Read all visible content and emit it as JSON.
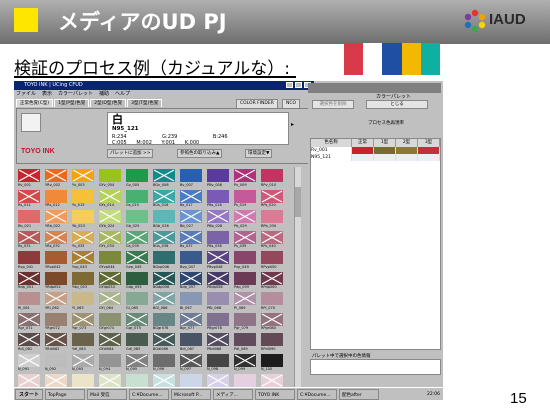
{
  "slide": {
    "title": "メディアのUD PJ",
    "logo_text": "IAUD",
    "subtitle": "検証のプロセス例（カジュアルな）:",
    "page_number": "15",
    "title_square_color": "#ffe600",
    "header_swatches": [
      "#d93a4a",
      "#ffffff",
      "#1f4fa3",
      "#f3b800",
      "#10b0a0"
    ]
  },
  "app": {
    "window_title": "TOYO INK | UCing CFUD",
    "menu": [
      "ファイル",
      "表示",
      "カラーパレット",
      "補助",
      "ヘルプ"
    ],
    "tabs": [
      "正常色覚(C型)",
      "1型(P型)色覚",
      "2型(D型)色覚",
      "3型(T型)色覚"
    ],
    "color_finder_label": "COLOR FINDER",
    "nco_label": "NCO",
    "selected_color": {
      "name": "白",
      "code": "N95_121",
      "rgb": [
        "R:234",
        "G:239",
        "B:246"
      ],
      "cmyk": [
        "C:005",
        "M:002",
        "Y:001",
        "K:000"
      ]
    },
    "brand": "TOYO INK",
    "buttons": [
      "パレットに追加 >>",
      "参照色の取り込み▲",
      "環境設定▼"
    ]
  },
  "swatch_grid": {
    "colors": [
      [
        "#c8242f",
        "#e86a1c",
        "#f2a30f",
        "#9ac21c",
        "#1e9a4c",
        "#138a8a",
        "#2a5fb0",
        "#5a3a9a",
        "#b0307a",
        "#c23462"
      ],
      [
        "#d34a4a",
        "#ef8a3a",
        "#f6c03a",
        "#b4d25a",
        "#48b070",
        "#3aa6a6",
        "#4a7cc6",
        "#7a5ab6",
        "#c45a9a",
        "#d0567a"
      ],
      [
        "#e06a6a",
        "#f39a5a",
        "#f8cc5a",
        "#c2dc7a",
        "#6ac28a",
        "#5ab8b8",
        "#6a94d2",
        "#9478c4",
        "#d07ab0",
        "#dc7a96"
      ],
      [
        "#b85858",
        "#d48452",
        "#d6ad50",
        "#a6b862",
        "#5aa676",
        "#4a9a9a",
        "#5a7cb6",
        "#7a64a6",
        "#b0648e",
        "#ba6a80"
      ],
      [
        "#8e3a3a",
        "#a85a30",
        "#a88030",
        "#7a8a3a",
        "#3a7a50",
        "#2e6e6e",
        "#3a5a8e",
        "#5a4680",
        "#8a466a",
        "#94485c"
      ],
      [
        "#6a3030",
        "#7a4a2a",
        "#7e6a34",
        "#5e6a34",
        "#2e5e40",
        "#245656",
        "#2e4670",
        "#463a66",
        "#6a3a56",
        "#70384a"
      ],
      [
        "#b89090",
        "#c4a088",
        "#c8b88a",
        "#aab48e",
        "#86a894",
        "#80a4a4",
        "#8898b4",
        "#9a8eb0",
        "#b092a8",
        "#b48e9c"
      ],
      [
        "#8a7070",
        "#9a8070",
        "#9e9272",
        "#8a9272",
        "#6a8a78",
        "#688686",
        "#6e7c94",
        "#7e7290",
        "#907488",
        "#94727e"
      ],
      [
        "#5a4a4a",
        "#665248",
        "#6a624c",
        "#5c624a",
        "#4a5c50",
        "#465a5a",
        "#4a5466",
        "#544c62",
        "#604c5c",
        "#644a54"
      ],
      [
        "#cfcfcf",
        "#bdbdbd",
        "#a9a9a9",
        "#959595",
        "#818181",
        "#6d6d6d",
        "#595959",
        "#454545",
        "#313131",
        "#1d1d1d"
      ],
      [
        "#e8d0d0",
        "#ecd8c8",
        "#ece4c8",
        "#dce4c8",
        "#c8e0d0",
        "#c8e0e0",
        "#cdd6e8",
        "#d6d0e8",
        "#e4d0e0",
        "#e8d0d8"
      ]
    ],
    "crossed": [
      [
        0,
        0
      ],
      [
        0,
        1
      ],
      [
        0,
        2
      ],
      [
        0,
        5
      ],
      [
        0,
        8
      ],
      [
        1,
        0
      ],
      [
        1,
        3
      ],
      [
        1,
        5
      ],
      [
        1,
        6
      ],
      [
        1,
        9
      ],
      [
        2,
        1
      ],
      [
        2,
        3
      ],
      [
        2,
        6
      ],
      [
        2,
        7
      ],
      [
        2,
        8
      ],
      [
        3,
        0
      ],
      [
        3,
        1
      ],
      [
        3,
        2
      ],
      [
        3,
        3
      ],
      [
        3,
        4
      ],
      [
        3,
        5
      ],
      [
        3,
        6
      ],
      [
        3,
        8
      ],
      [
        3,
        9
      ],
      [
        4,
        2
      ],
      [
        4,
        4
      ],
      [
        4,
        7
      ],
      [
        5,
        0
      ],
      [
        5,
        3
      ],
      [
        5,
        5
      ],
      [
        5,
        6
      ],
      [
        5,
        7
      ],
      [
        5,
        9
      ],
      [
        6,
        1
      ],
      [
        6,
        3
      ],
      [
        6,
        5
      ],
      [
        6,
        8
      ],
      [
        7,
        0
      ],
      [
        7,
        2
      ],
      [
        7,
        4
      ],
      [
        7,
        6
      ],
      [
        7,
        9
      ],
      [
        8,
        0
      ],
      [
        8,
        1
      ],
      [
        8,
        3
      ],
      [
        8,
        5
      ],
      [
        8,
        7
      ],
      [
        9,
        0
      ],
      [
        9,
        2
      ],
      [
        9,
        4
      ],
      [
        9,
        6
      ],
      [
        9,
        8
      ],
      [
        10,
        0
      ],
      [
        10,
        1
      ],
      [
        10,
        3
      ],
      [
        10,
        5
      ],
      [
        10,
        7
      ],
      [
        10,
        9
      ]
    ],
    "labels": [
      [
        "Rv_001",
        "YRv_002",
        "Yv_003",
        "GYv_004",
        "Gv_005",
        "BGv_006",
        "Bv_007",
        "PBv_008",
        "Pv_009",
        "RPv_010"
      ],
      [
        "Rs_011",
        "YRs_012",
        "Ys_013",
        "GYs_014",
        "Gs_015",
        "BGs_016",
        "Bs_017",
        "PBs_018",
        "Ps_019",
        "RPs_020"
      ],
      [
        "Rb_021",
        "YRb_022",
        "Yb_023",
        "GYb_024",
        "Gb_025",
        "BGb_026",
        "Bb_027",
        "PBb_028",
        "Pb_029",
        "RPb_030"
      ],
      [
        "Rs_031",
        "YRs_032",
        "Ys_033",
        "GYs_034",
        "Gs_035",
        "BGs_036",
        "Bs_037",
        "PBs_038",
        "Ps_039",
        "RPs_040"
      ],
      [
        "Rvp_041",
        "YRvp042",
        "Yvp_043",
        "GYvp044",
        "Gvp_045",
        "BGvp046",
        "Bvp_047",
        "PBvp048",
        "Pvp_049",
        "RPvp050"
      ],
      [
        "Rdp_051",
        "YRdp052",
        "Ydp_053",
        "GYdp054",
        "Gdp_055",
        "BGdp056",
        "Bdp_057",
        "PBdp058",
        "Pdp_059",
        "RPdp060"
      ],
      [
        "Rl_061",
        "YRl_062",
        "Yl_063",
        "GYl_064",
        "Gl_065",
        "BGl_066",
        "Bl_067",
        "PBl_068",
        "Pl_069",
        "RPl_070"
      ],
      [
        "Rgr_071",
        "YRgr072",
        "Ygr_073",
        "GYgr074",
        "Ggr_075",
        "BGgr076",
        "Bgr_077",
        "PBgr078",
        "Pgr_079",
        "RPgr080"
      ],
      [
        "Rdl_081",
        "YRdl082",
        "Ydl_083",
        "GYdl084",
        "Gdl_085",
        "BGdl086",
        "Bdl_087",
        "PBdl088",
        "Pdl_089",
        "RPdl090"
      ],
      [
        "N_091",
        "N_092",
        "N_093",
        "N_094",
        "N_095",
        "N_096",
        "N_097",
        "N_098",
        "N_099",
        "N_100"
      ],
      [
        "Rvp_101",
        "YRvp102",
        "Yvp_103",
        "GYvp104",
        "Gvp_105",
        "BGvp106",
        "Bvp_107",
        "PBvp108",
        "Pvp_109",
        "RPvp110"
      ]
    ]
  },
  "palette": {
    "title": "カラーパレット",
    "btn_disabled": "選択色を削除",
    "btn_close": "とじる",
    "process_label": "プロセス色再現率",
    "headers": [
      "色名称",
      "正常",
      "1型",
      "2型",
      "3型"
    ],
    "rows": [
      {
        "name": "Rv_001",
        "colors": [
          "#c8242f",
          "#7a6a30",
          "#8a7a2a",
          "#c23040"
        ]
      },
      {
        "name": "N95_121",
        "colors": [
          "#eaeff6",
          "#eaeff6",
          "#eaeff6",
          "#eaeff6"
        ]
      }
    ],
    "footer_label": "パレット中で選択中の色情報"
  },
  "taskbar": {
    "start": "スタート",
    "items": [
      "TopPage",
      "Mail 受信",
      "C:¥Docume...",
      "Microsoft P...",
      "メディア...",
      "TOYO INK",
      "C:¥Docume...",
      "配色after"
    ],
    "clock": "22:06"
  }
}
